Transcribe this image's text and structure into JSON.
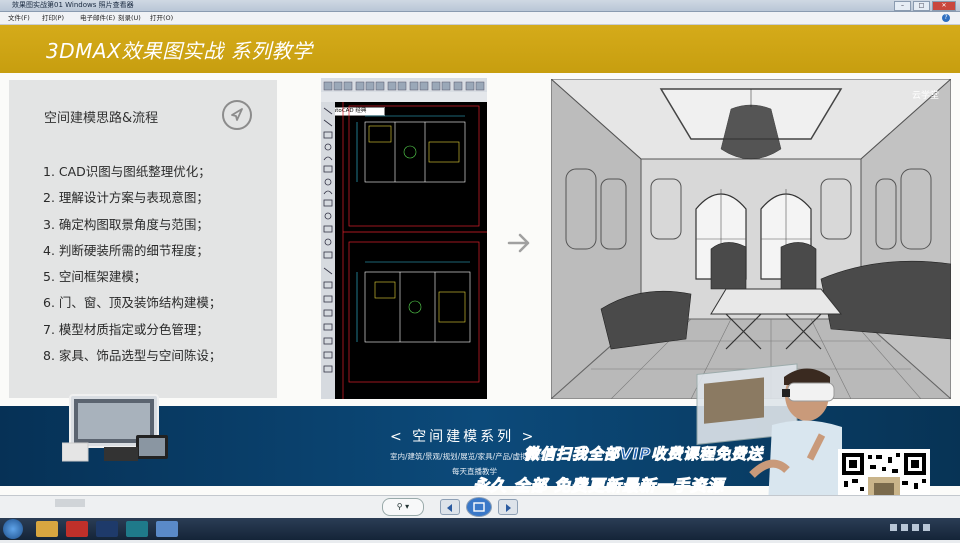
{
  "window": {
    "title": "效果图实战第01  Windows 照片查看器",
    "buttons": [
      "–",
      "□",
      "✕"
    ]
  },
  "menu": {
    "items": [
      "文件(F)",
      "打印(P)",
      "电子邮件(E)",
      "刻录(U)",
      "打开(O)"
    ]
  },
  "slide": {
    "header_title": "3DMAX效果图实战  系列教学",
    "panel_title": "空间建模思路&流程",
    "steps": [
      "1.  CAD识图与图纸整理优化；",
      "2.  理解设计方案与表现意图；",
      "3.  确定构图取景角度与范围；",
      "4.  判断硬装所需的细节程度；",
      "5.  空间框架建模；",
      "6.  门、窗、顶及装饰结构建模；",
      "7.  模型材质指定或分色管理；",
      "8.  家具、饰品选型与空间陈设；"
    ],
    "cad_label": "AutoCAD 经典",
    "render_logo": "云学堂",
    "series_title": "<  空间建模系列  >",
    "categories": "室内/建筑/景观/规划/展览/家具/产品/虚拟现实",
    "live_label": "每天直播教学",
    "watermark_line1": "微信扫我全部VIP收费课程免费送",
    "watermark_line2": "永久   全部   免费更新最新一手资源"
  },
  "player": {
    "zoom_label": "⚲ ▾"
  },
  "colors": {
    "header_gold": "#c99f12",
    "band_blue": "#0a3f6b",
    "panel_gray": "#e3e4e4"
  },
  "icons": {
    "panel_icon": "navigation-arrow-icon",
    "between_images": "right-arrow-icon"
  }
}
